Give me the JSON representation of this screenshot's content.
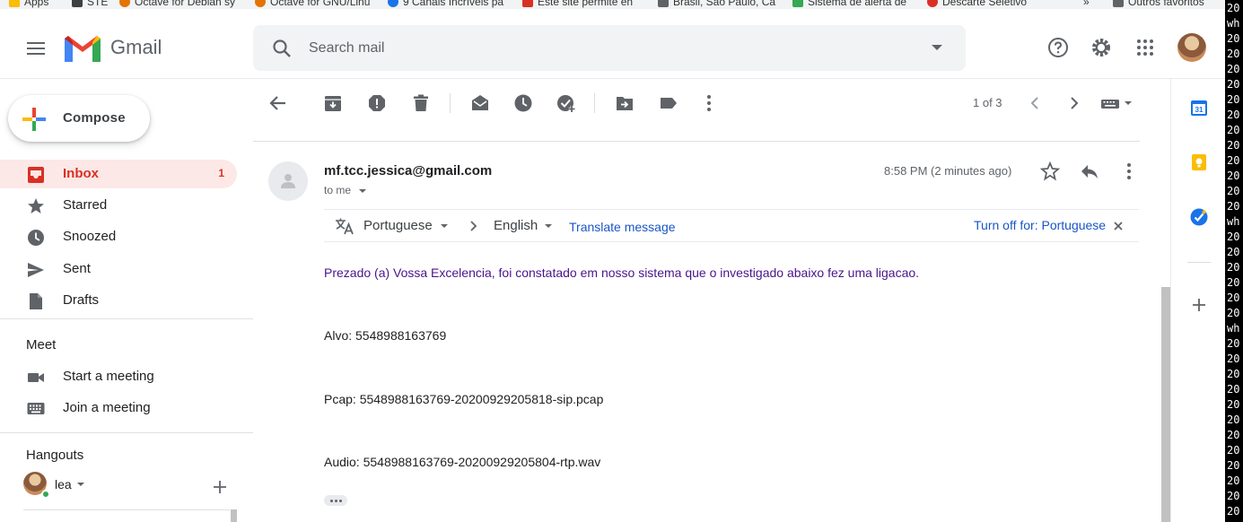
{
  "bookmarks": [
    {
      "label": "Apps",
      "color": "#fbbc04"
    },
    {
      "label": "STE",
      "color": "#3c4043"
    },
    {
      "label": "Octave for Debian sy",
      "color": "#e37400"
    },
    {
      "label": "Octave for GNU/Linu",
      "color": "#e37400"
    },
    {
      "label": "9 Canais Incríveis pa",
      "color": "#1a73e8"
    },
    {
      "label": "Este site permite en",
      "color": "#d93025"
    },
    {
      "label": "Brasil, São Paulo, Ca",
      "color": "#5f6368"
    },
    {
      "label": "Sistema de alerta de",
      "color": "#34a853"
    },
    {
      "label": "Descarte Seletivo",
      "color": "#d93025"
    },
    {
      "label": "»",
      "color": ""
    },
    {
      "label": "Outros favoritos",
      "color": "#5f6368"
    }
  ],
  "terminal_lines": [
    "20",
    "wh",
    "20",
    "20",
    "20",
    "20",
    "20",
    "20",
    "20",
    "20",
    "20",
    "20",
    "20",
    "20",
    "wh",
    "20",
    "20",
    "20",
    "20",
    "20",
    "20",
    "wh",
    "20",
    "20",
    "20",
    "20",
    "20",
    "20",
    "20",
    "20",
    "20",
    "20",
    "20",
    "20"
  ],
  "header": {
    "app_name": "Gmail",
    "search_placeholder": "Search mail"
  },
  "sidebar": {
    "compose_label": "Compose",
    "items": [
      {
        "label": "Inbox",
        "count": "1",
        "icon": "inbox-icon"
      },
      {
        "label": "Starred",
        "count": "",
        "icon": "star-icon"
      },
      {
        "label": "Snoozed",
        "count": "",
        "icon": "clock-icon"
      },
      {
        "label": "Sent",
        "count": "",
        "icon": "send-icon"
      },
      {
        "label": "Drafts",
        "count": "",
        "icon": "draft-icon"
      }
    ],
    "meet": {
      "title": "Meet",
      "items": [
        {
          "label": "Start a meeting",
          "icon": "video-icon"
        },
        {
          "label": "Join a meeting",
          "icon": "keyboard-icon"
        }
      ]
    },
    "hangouts": {
      "title": "Hangouts",
      "user": "lea"
    }
  },
  "toolbar": {
    "pager": "1 of 3"
  },
  "message": {
    "sender": "mf.tcc.jessica@gmail.com",
    "recipient": "to me",
    "time": "8:58 PM (2 minutes ago)",
    "translate": {
      "from_lang": "Portuguese",
      "to_lang": "English",
      "translate_link": "Translate message",
      "turn_off": "Turn off for: Portuguese"
    },
    "body": [
      "Prezado (a) Vossa Excelencia, foi constatado em nosso sistema que o investigado abaixo fez uma ligacao.",
      "Alvo: 5548988163769",
      "Pcap: 5548988163769-20200929205818-sip.pcap",
      "Audio: 5548988163769-20200929205804-rtp.wav"
    ]
  },
  "colors": {
    "accent_red": "#d93025",
    "link_blue": "#1a56c6",
    "body_purple": "#4a148c",
    "active_bg": "#fce8e6"
  }
}
